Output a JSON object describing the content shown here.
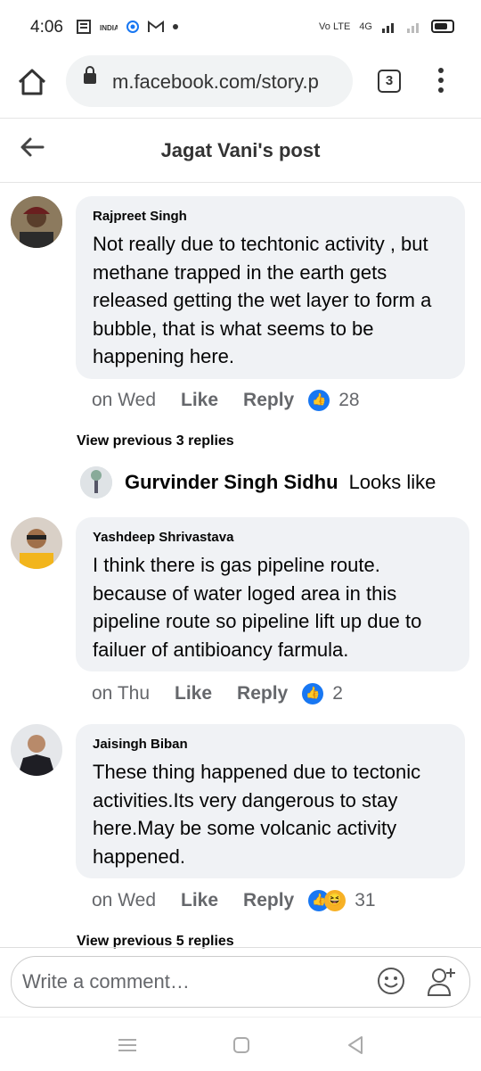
{
  "status": {
    "time": "4:06",
    "icons": [
      "news-icon",
      "india-tv-icon",
      "signal-dot-icon",
      "gmail-icon"
    ],
    "right_labels": [
      "Vo LTE",
      "4G"
    ],
    "battery": "battery-icon"
  },
  "browser": {
    "url": "m.facebook.com/story.p",
    "tab_count": "3"
  },
  "header": {
    "title": "Jagat Vani's post"
  },
  "comments": [
    {
      "name": "Rajpreet Singh",
      "text": "Not really due to techtonic activity , but methane trapped in the earth gets released getting the wet layer to form a bubble, that is what seems to be happening here.",
      "day": "on Wed",
      "like": "Like",
      "reply": "Reply",
      "reactions": "28"
    },
    {
      "name": "Yashdeep Shrivastava",
      "text": "I think there is gas pipeline route. because of  water loged area in this pipeline route so pipeline lift up due to failuer of antibioancy farmula.",
      "day": "on Thu",
      "like": "Like",
      "reply": "Reply",
      "reactions": "2"
    },
    {
      "name": "Jaisingh Biban",
      "text": "These thing happened due to tectonic activities.Its very dangerous to stay here.May be some volcanic activity happened.",
      "day": "on Wed",
      "like": "Like",
      "reply": "Reply",
      "reactions": "31"
    }
  ],
  "view_previous_1": "View previous 3 replies",
  "reply_preview": {
    "name": "Gurvinder Singh Sidhu",
    "text": "Looks like"
  },
  "view_previous_2": "View previous 5 replies",
  "composer": {
    "placeholder": "Write a comment…"
  }
}
